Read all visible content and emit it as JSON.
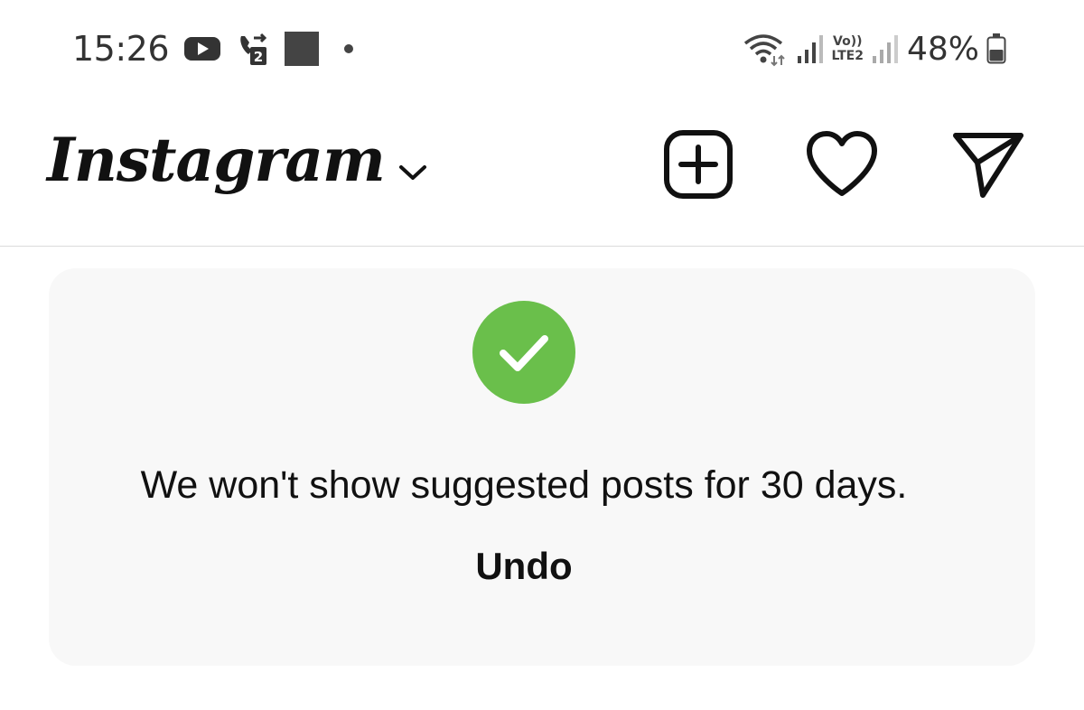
{
  "status_bar": {
    "time": "15:26",
    "left_icons": [
      "youtube-icon",
      "call-forward-icon",
      "app-square-icon",
      "notification-dot-icon"
    ],
    "volte_top": "Vo))",
    "volte_bottom": "LTE2",
    "battery_percent": "48%",
    "battery_level": 0.48
  },
  "header": {
    "app_name": "Instagram",
    "icons": [
      "new-post-icon",
      "heart-icon",
      "direct-message-icon"
    ]
  },
  "notice": {
    "message": "We won't show suggested posts for 30 days.",
    "undo_label": "Undo",
    "check_color": "#6abf4b"
  }
}
